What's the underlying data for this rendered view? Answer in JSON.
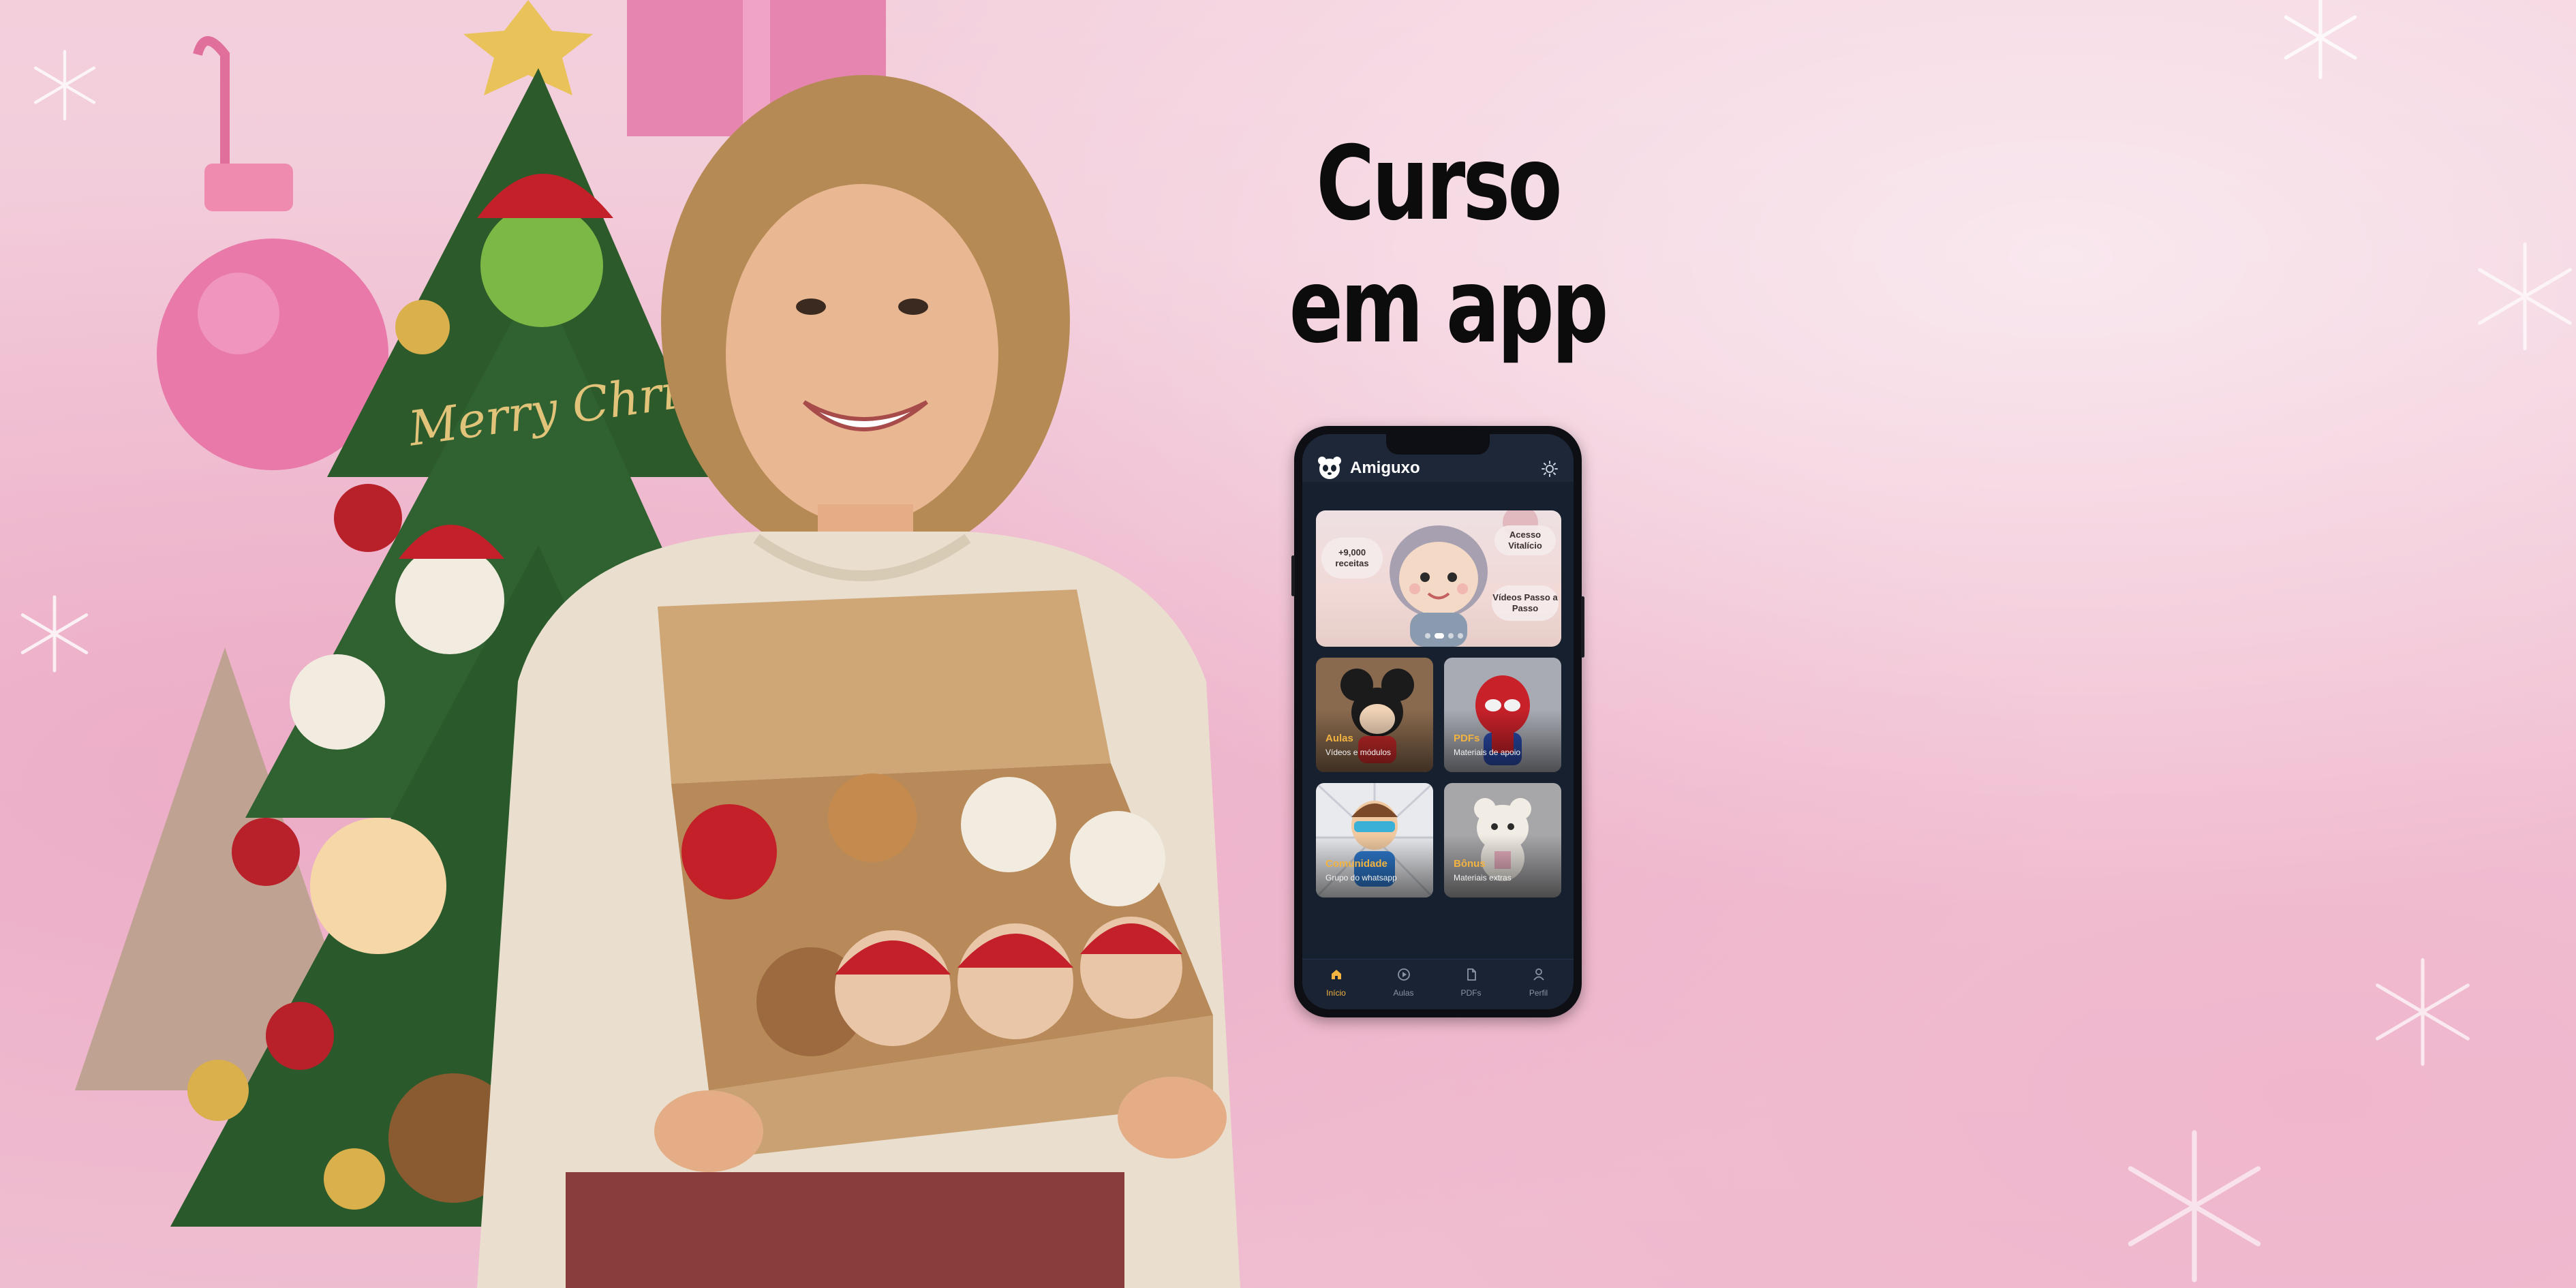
{
  "headline": {
    "line1": "Curso",
    "line2": "em app"
  },
  "photo": {
    "banner_text": "Merry Christmas",
    "colors": {
      "sweater": "#eadfcf",
      "box": "#c9a172",
      "tree": "#2d5a2a"
    }
  },
  "app": {
    "title": "Amiguxo",
    "logo_icon": "panda-icon",
    "theme_icon": "sun-icon",
    "banner": {
      "bubbles": [
        "+9,000 receitas",
        "Acesso Vitalício",
        "Vídeos Passo a Passo"
      ]
    },
    "cards": [
      {
        "title": "Aulas",
        "subtitle": "Vídeos e módulos",
        "icon": "mouse-amigurumi"
      },
      {
        "title": "PDFs",
        "subtitle": "Materiais de apoio",
        "icon": "spider-amigurumi"
      },
      {
        "title": "Comunidade",
        "subtitle": "Grupo do whatsapp",
        "icon": "hero-amigurumi"
      },
      {
        "title": "Bônus",
        "subtitle": "Materiais extras",
        "icon": "bear-amigurumi"
      }
    ],
    "nav": [
      {
        "label": "Início",
        "icon": "home-icon",
        "active": true
      },
      {
        "label": "Aulas",
        "icon": "play-circle-icon",
        "active": false
      },
      {
        "label": "PDFs",
        "icon": "file-icon",
        "active": false
      },
      {
        "label": "Perfil",
        "icon": "user-icon",
        "active": false
      }
    ],
    "colors": {
      "accent": "#f2b340",
      "background": "#17202f",
      "header": "#1d2738"
    }
  }
}
